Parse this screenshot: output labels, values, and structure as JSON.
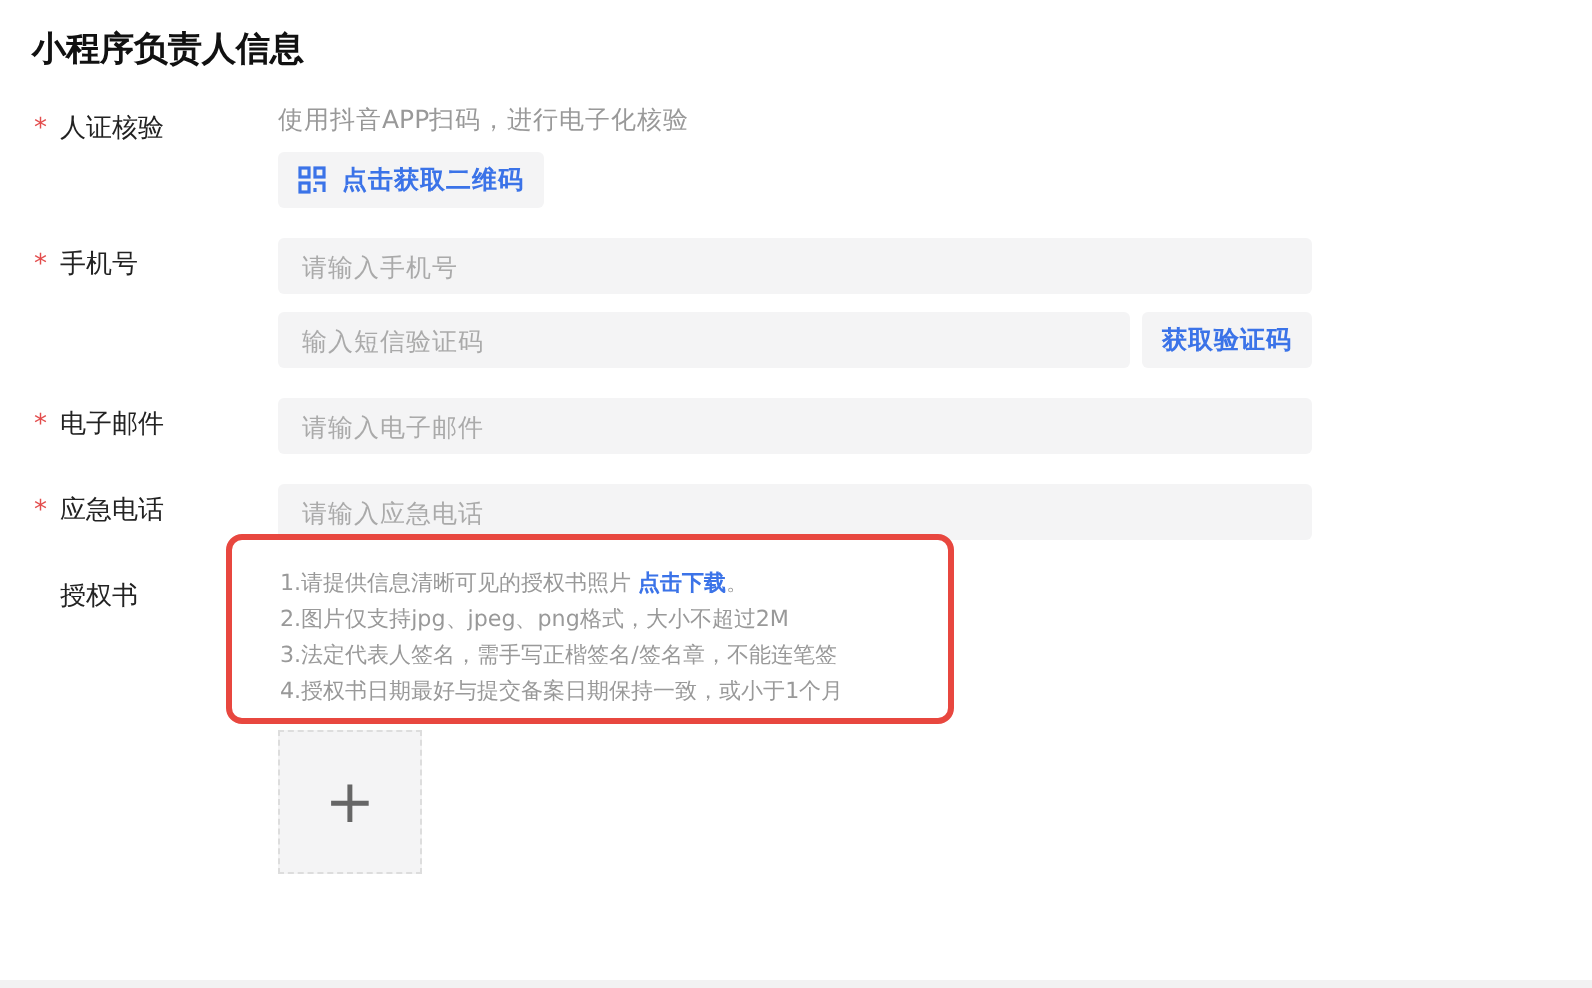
{
  "title": "小程序负责人信息",
  "required_mark": "*",
  "fields": [
    {
      "kind": "qr",
      "required": true,
      "label": "人证核验",
      "hint": "使用抖音APP扫码，进行电子化核验",
      "button": "点击获取二维码"
    },
    {
      "kind": "phone",
      "required": true,
      "label": "手机号",
      "placeholder": "请输入手机号",
      "code_placeholder": "输入短信验证码",
      "button": "获取验证码"
    },
    {
      "kind": "input",
      "required": true,
      "label": "电子邮件",
      "placeholder": "请输入电子邮件"
    },
    {
      "kind": "input",
      "required": true,
      "label": "应急电话",
      "placeholder": "请输入应急电话"
    },
    {
      "kind": "upload",
      "required": false,
      "label": "授权书",
      "upload_symbol": "+",
      "notes": [
        {
          "text": "1.请提供信息清晰可见的授权书照片 ",
          "link": "点击下载",
          "tail": "。"
        },
        {
          "text": "2.图片仅支持jpg、jpeg、png格式，大小不超过2M"
        },
        {
          "text": "3.法定代表人签名，需手写正楷签名/签名章，不能连笔签"
        },
        {
          "text": "4.授权书日期最好与提交备案日期保持一致，或小于1个月"
        }
      ]
    }
  ]
}
